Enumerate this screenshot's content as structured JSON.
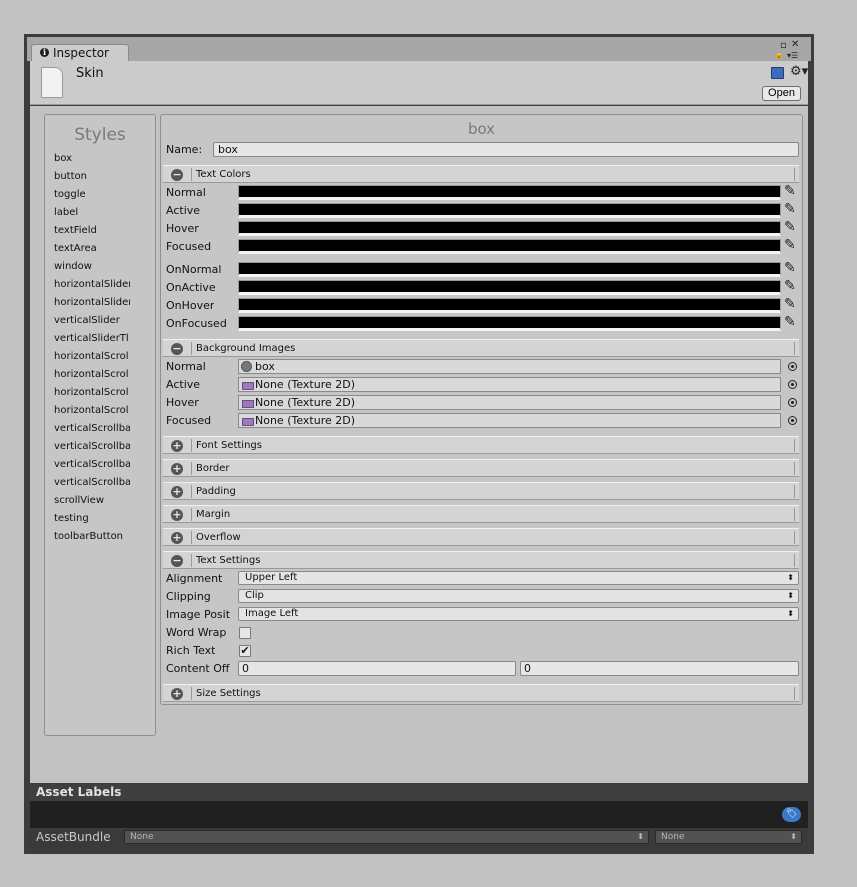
{
  "window": {
    "tab_title": "Inspector",
    "tab_icon": "info-icon",
    "controls": {
      "maximize": "▫",
      "close": "✕",
      "lock": "🔒",
      "menu": "▾☰"
    }
  },
  "header": {
    "asset_name": "Skin",
    "open_label": "Open",
    "icons": [
      "book-help-icon",
      "gear-icon"
    ]
  },
  "styles_panel": {
    "title": "Styles",
    "items": [
      "box",
      "button",
      "toggle",
      "label",
      "textField",
      "textArea",
      "window",
      "horizontalSlider",
      "horizontalSlider",
      "verticalSlider",
      "verticalSliderTl",
      "horizontalScrol",
      "horizontalScrol",
      "horizontalScrol",
      "horizontalScrol",
      "verticalScrollba",
      "verticalScrollba",
      "verticalScrollba",
      "verticalScrollba",
      "scrollView",
      "testing",
      "toolbarButton"
    ]
  },
  "editor": {
    "heading": "box",
    "name_label": "Name:",
    "name_value": "box",
    "text_colors": {
      "title": "Text Colors",
      "expanded": true,
      "rows": [
        "Normal",
        "Active",
        "Hover",
        "Focused"
      ],
      "on_rows": [
        "OnNormal",
        "OnActive",
        "OnHover",
        "OnFocused"
      ],
      "color": "#000000"
    },
    "background_images": {
      "title": "Background Images",
      "expanded": true,
      "rows": [
        {
          "label": "Normal",
          "value": "box"
        },
        {
          "label": "Active",
          "value": "None (Texture 2D)"
        },
        {
          "label": "Hover",
          "value": "None (Texture 2D)"
        },
        {
          "label": "Focused",
          "value": "None (Texture 2D)"
        }
      ]
    },
    "collapsed_sections": [
      "Font Settings",
      "Border",
      "Padding",
      "Margin",
      "Overflow"
    ],
    "text_settings": {
      "title": "Text Settings",
      "expanded": true,
      "alignment_label": "Alignment",
      "alignment_value": "Upper Left",
      "clipping_label": "Clipping",
      "clipping_value": "Clip",
      "image_position_label": "Image Posit",
      "image_position_value": "Image Left",
      "word_wrap_label": "Word Wrap",
      "word_wrap": false,
      "rich_text_label": "Rich Text",
      "rich_text": true,
      "content_offset_label": "Content Off",
      "content_offset_x": "0",
      "content_offset_y": "0"
    },
    "size_settings": {
      "title": "Size Settings",
      "expanded": false
    }
  },
  "asset_labels": {
    "title": "Asset Labels",
    "bundle_label": "AssetBundle",
    "bundle_name": "None",
    "bundle_variant": "None"
  },
  "colors": {
    "window_frame": "#3c3c3c",
    "panel_bg": "#c2c2c2",
    "accent_blue": "#3a78c8"
  }
}
